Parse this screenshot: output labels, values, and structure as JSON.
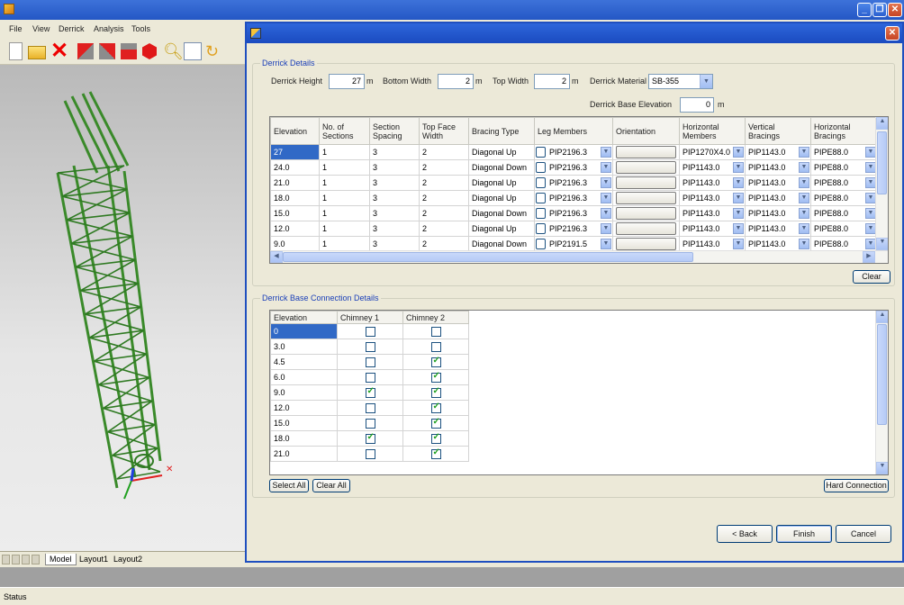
{
  "app": {
    "menu": [
      "File",
      "View",
      "Derrick",
      "Analysis",
      "Tools"
    ],
    "layout_tabs": [
      "Model",
      "Layout1",
      "Layout2"
    ],
    "status": "Status"
  },
  "dialog": {
    "derrick_details": {
      "legend": "Derrick Details",
      "height_label": "Derrick Height",
      "height_value": "27",
      "height_unit": "m",
      "bottom_width_label": "Bottom Width",
      "bottom_width_value": "2",
      "bottom_width_unit": "m",
      "top_width_label": "Top Width",
      "top_width_value": "2",
      "top_width_unit": "m",
      "material_label": "Derrick Material",
      "material_value": "SB-355",
      "base_elevation_label": "Derrick Base Elevation",
      "base_elevation_value": "0",
      "base_elevation_unit": "m",
      "columns": [
        "Elevation",
        "No. of Sections",
        "Section Spacing",
        "Top Face Width",
        "Bracing Type",
        "Leg Members",
        "Orientation",
        "Horizontal Members",
        "Vertical Bracings",
        "Horizontal Bracings"
      ],
      "rows": [
        {
          "elevation": "27",
          "sections": "1",
          "spacing": "3",
          "width": "2",
          "bracing": "Diagonal Up",
          "leg": "PIP2196.3",
          "horiz": "PIP1270X4.0",
          "vert": "PIP1143.0",
          "hbrace": "PIPE88.0"
        },
        {
          "elevation": "24.0",
          "sections": "1",
          "spacing": "3",
          "width": "2",
          "bracing": "Diagonal Down",
          "leg": "PIP2196.3",
          "horiz": "PIP1143.0",
          "vert": "PIP1143.0",
          "hbrace": "PIPE88.0"
        },
        {
          "elevation": "21.0",
          "sections": "1",
          "spacing": "3",
          "width": "2",
          "bracing": "Diagonal Up",
          "leg": "PIP2196.3",
          "horiz": "PIP1143.0",
          "vert": "PIP1143.0",
          "hbrace": "PIPE88.0"
        },
        {
          "elevation": "18.0",
          "sections": "1",
          "spacing": "3",
          "width": "2",
          "bracing": "Diagonal Up",
          "leg": "PIP2196.3",
          "horiz": "PIP1143.0",
          "vert": "PIP1143.0",
          "hbrace": "PIPE88.0"
        },
        {
          "elevation": "15.0",
          "sections": "1",
          "spacing": "3",
          "width": "2",
          "bracing": "Diagonal Down",
          "leg": "PIP2196.3",
          "horiz": "PIP1143.0",
          "vert": "PIP1143.0",
          "hbrace": "PIPE88.0"
        },
        {
          "elevation": "12.0",
          "sections": "1",
          "spacing": "3",
          "width": "2",
          "bracing": "Diagonal Up",
          "leg": "PIP2196.3",
          "horiz": "PIP1143.0",
          "vert": "PIP1143.0",
          "hbrace": "PIPE88.0"
        },
        {
          "elevation": "9.0",
          "sections": "1",
          "spacing": "3",
          "width": "2",
          "bracing": "Diagonal Down",
          "leg": "PIP2191.5",
          "horiz": "PIP1143.0",
          "vert": "PIP1143.0",
          "hbrace": "PIPE88.0"
        }
      ],
      "clear_label": "Clear"
    },
    "base_connection": {
      "legend": "Derrick Base Connection Details",
      "columns": [
        "Elevation",
        "Chimney 1",
        "Chimney 2"
      ],
      "rows": [
        {
          "elevation": "0",
          "c1": false,
          "c2": false
        },
        {
          "elevation": "3.0",
          "c1": false,
          "c2": false
        },
        {
          "elevation": "4.5",
          "c1": false,
          "c2": true
        },
        {
          "elevation": "6.0",
          "c1": false,
          "c2": true
        },
        {
          "elevation": "9.0",
          "c1": true,
          "c2": true
        },
        {
          "elevation": "12.0",
          "c1": false,
          "c2": true
        },
        {
          "elevation": "15.0",
          "c1": false,
          "c2": true
        },
        {
          "elevation": "18.0",
          "c1": true,
          "c2": true
        },
        {
          "elevation": "21.0",
          "c1": false,
          "c2": true
        }
      ],
      "select_all_label": "Select All",
      "clear_all_label": "Clear All",
      "hard_connection_label": "Hard Connection"
    },
    "back_label": "< Back",
    "finish_label": "Finish",
    "cancel_label": "Cancel"
  },
  "colors": {
    "model_green": "#3a8a2a",
    "selection": "#3169c6",
    "title_blue": "#2457c5"
  }
}
